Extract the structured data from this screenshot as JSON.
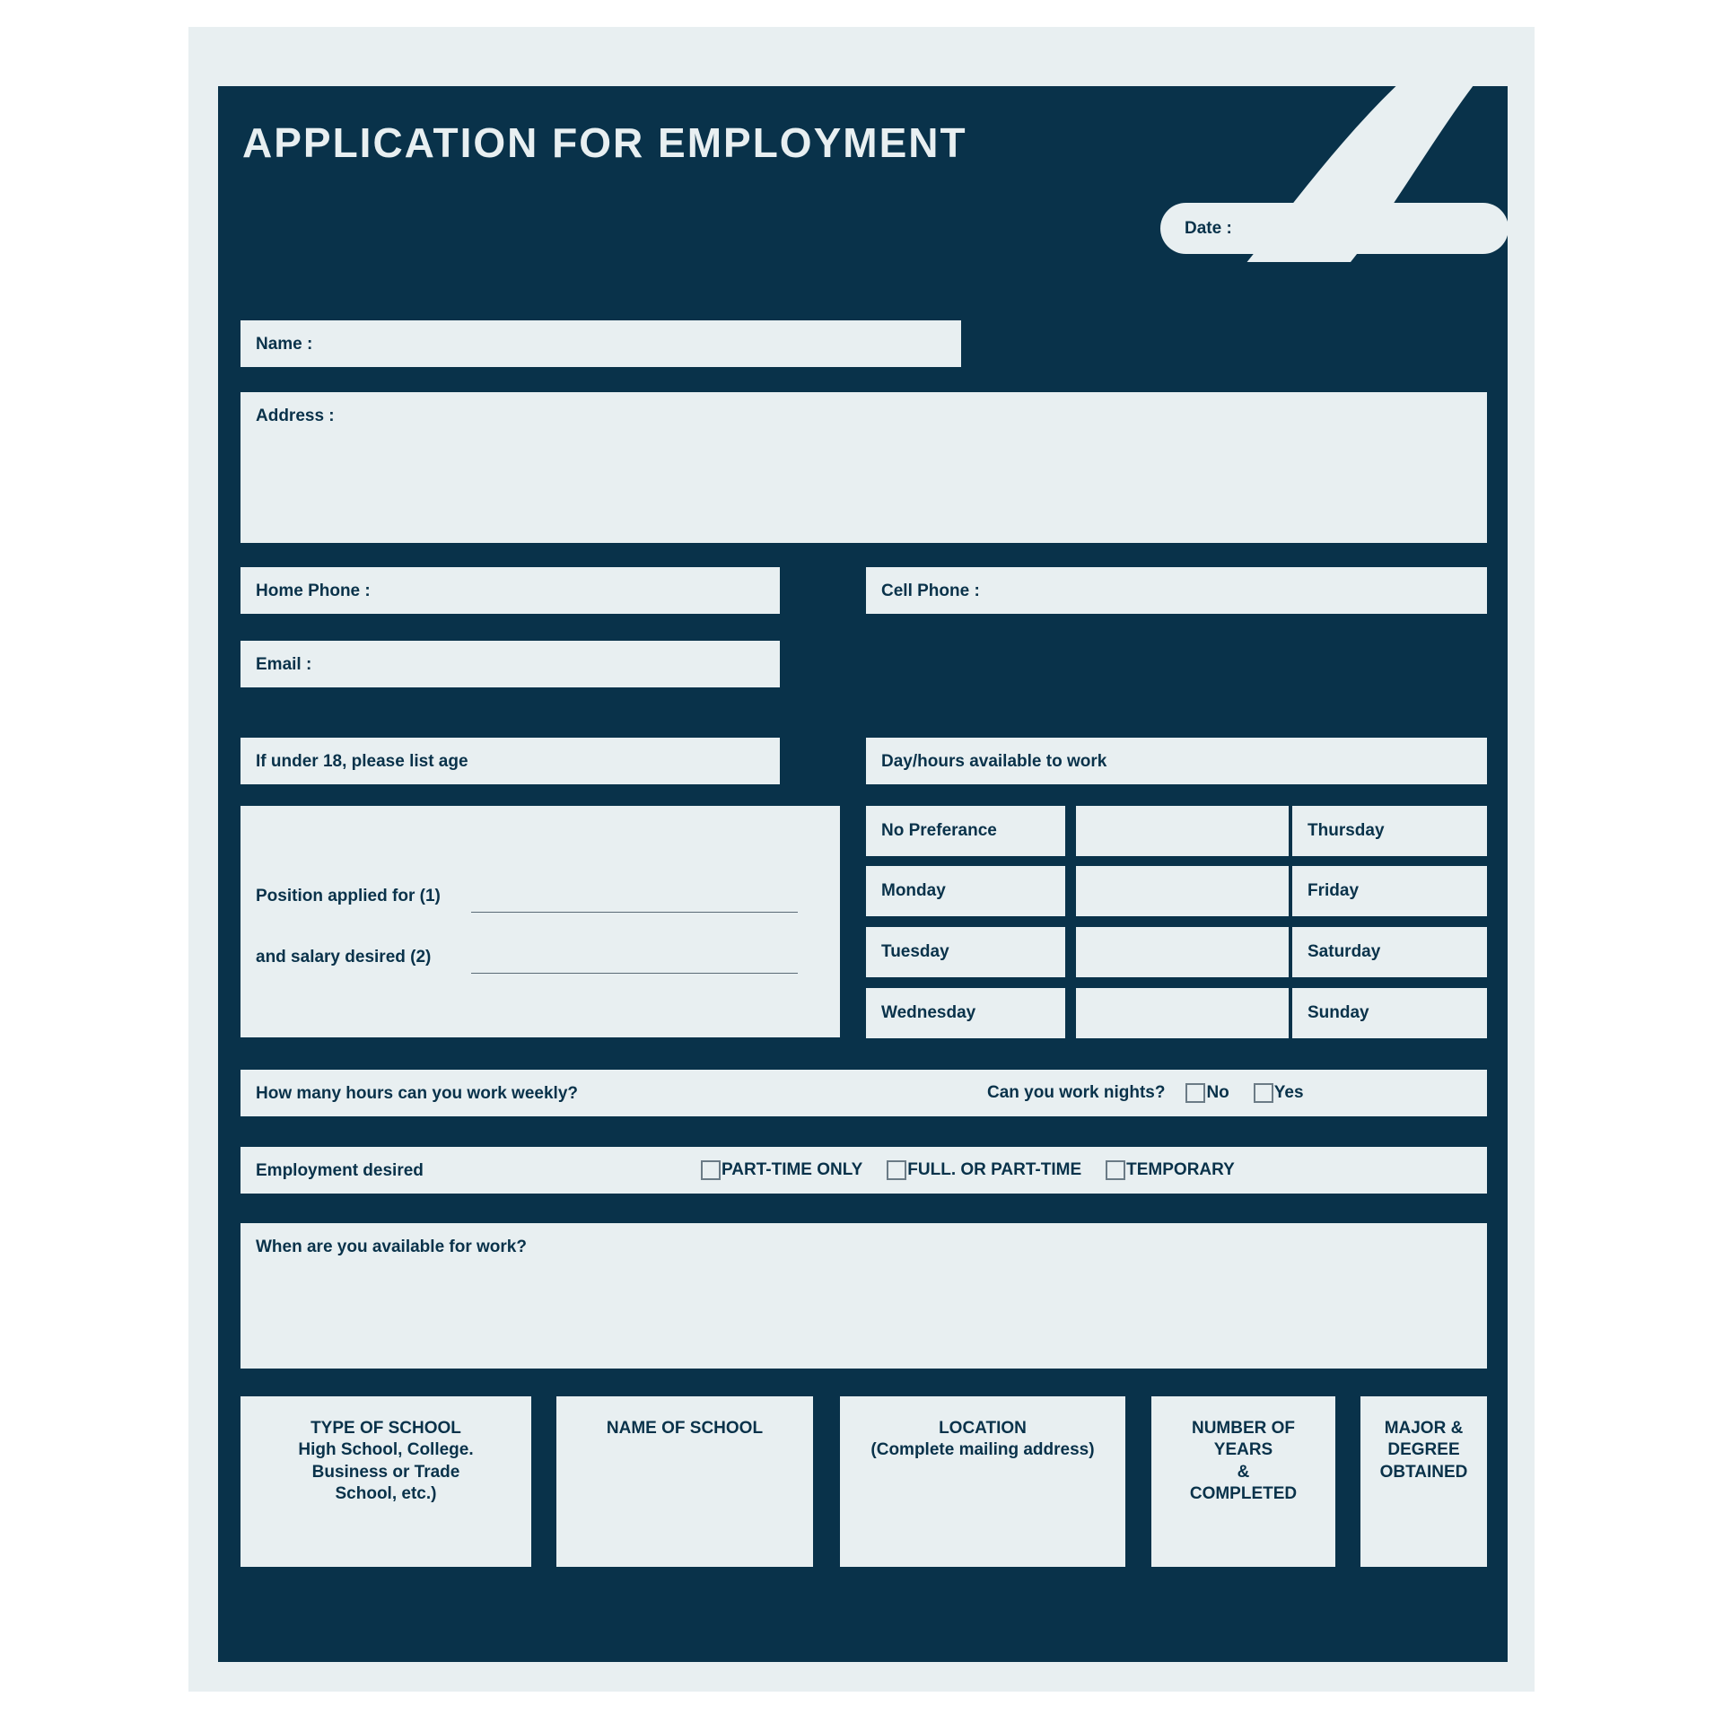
{
  "document": {
    "title": "APPLICATION FOR EMPLOYMENT",
    "date_label": "Date :"
  },
  "colors": {
    "navy": "#09324a",
    "light": "#e8eff1",
    "checkbox_border": "#6b7b86",
    "rule": "#5a6b76"
  },
  "personal": {
    "name_label": "Name :",
    "address_label": "Address :",
    "home_phone_label": "Home Phone :",
    "cell_phone_label": "Cell Phone :",
    "email_label": "Email :",
    "under18_label": "If under 18, please list age"
  },
  "availability": {
    "header": "Day/hours available to work",
    "rows": [
      {
        "left": "No Preferance",
        "hours": "",
        "right": "Thursday"
      },
      {
        "left": "Monday",
        "hours": "",
        "right": "Friday"
      },
      {
        "left": "Tuesday",
        "hours": "",
        "right": "Saturday"
      },
      {
        "left": "Wednesday",
        "hours": "",
        "right": "Sunday"
      }
    ]
  },
  "position": {
    "line1_label": "Position applied for (1)",
    "line1_value": "",
    "line2_label": "and salary desired (2)",
    "line2_value": ""
  },
  "hours": {
    "weekly_label": "How many hours can you work weekly?",
    "weekly_value": "",
    "nights_label": "Can you work nights?",
    "nights_options": [
      "No",
      "Yes"
    ]
  },
  "employment_desired": {
    "label": "Employment desired",
    "options": [
      "PART-TIME ONLY",
      "FULL. OR PART-TIME",
      "TEMPORARY"
    ]
  },
  "available_when": {
    "label": "When are you available for work?",
    "value": ""
  },
  "education": {
    "columns": [
      "TYPE OF SCHOOL\nHigh School, College.\nBusiness or Trade\nSchool, etc.)",
      "NAME OF SCHOOL",
      "LOCATION\n(Complete mailing address)",
      "NUMBER OF\nYEARS\n&\nCOMPLETED",
      "MAJOR &\nDEGREE\nOBTAINED"
    ]
  }
}
